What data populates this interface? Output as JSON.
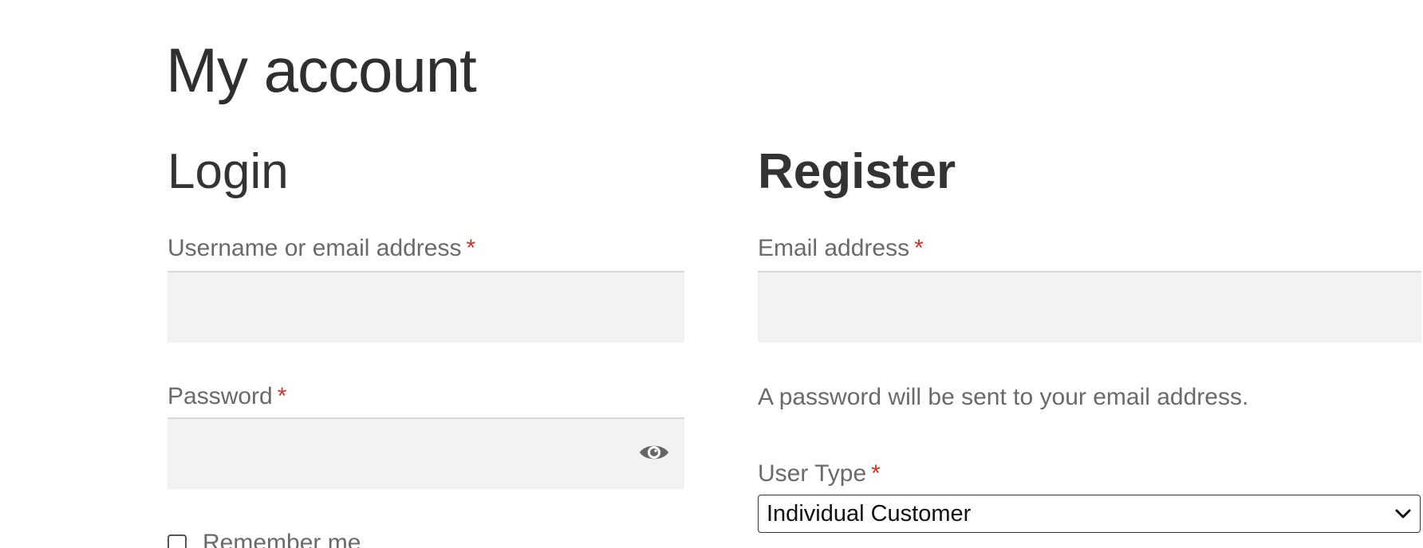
{
  "page": {
    "title": "My account"
  },
  "login": {
    "heading": "Login",
    "username_label": "Username or email address",
    "username_value": "",
    "password_label": "Password",
    "password_value": "",
    "required_marker": "*",
    "remember_label": "Remember me",
    "remember_checked": false,
    "show_password_icon": "eye-icon"
  },
  "register": {
    "heading": "Register",
    "email_label": "Email address",
    "email_value": "",
    "required_marker": "*",
    "password_note": "A password will be sent to your email address.",
    "user_type_label": "User Type",
    "user_type_value": "Individual Customer",
    "dropdown_icon": "chevron-down-icon"
  },
  "colors": {
    "required": "#c0392b",
    "input_background": "#f2f2f2",
    "heading_text": "#333333",
    "label_text": "#6a6a6a"
  }
}
